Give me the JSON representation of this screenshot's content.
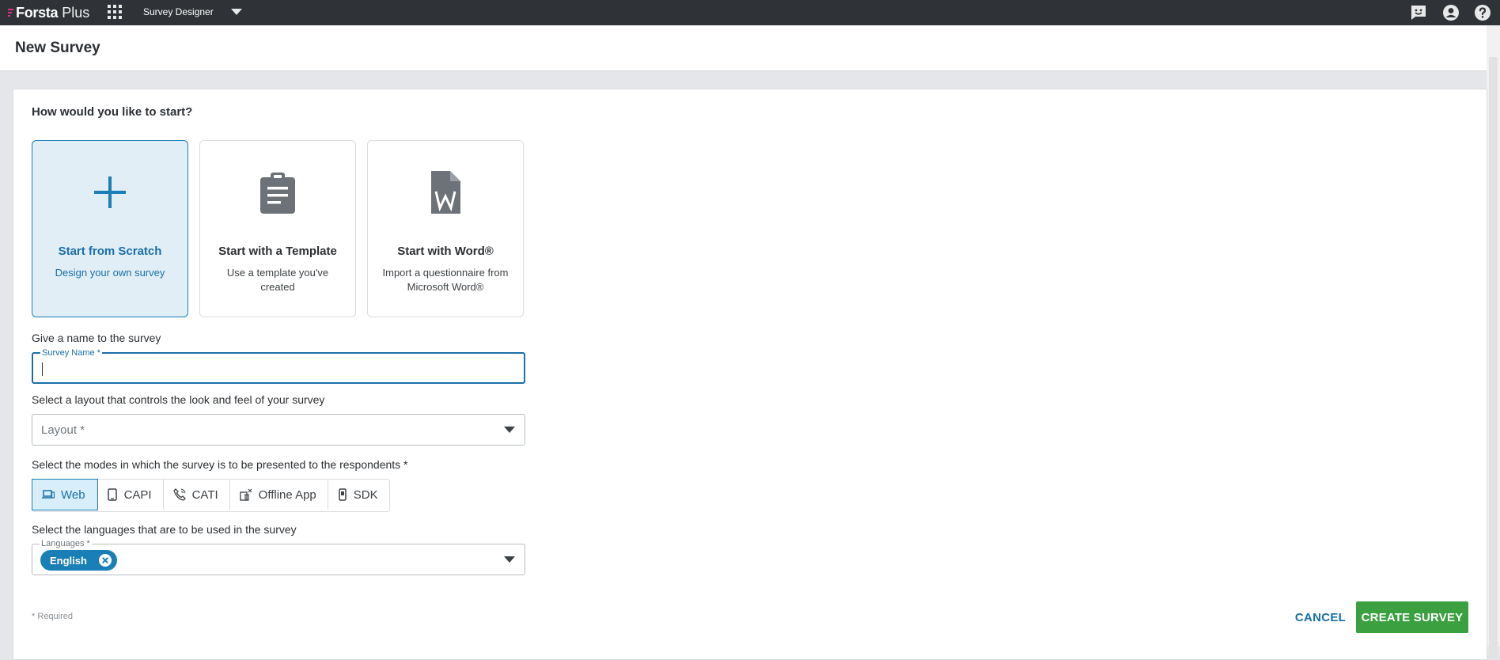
{
  "topbar": {
    "brand": "Forsta",
    "brand_suffix": "Plus",
    "app_name": "Survey Designer",
    "icons": [
      "apps-grid-icon",
      "chevron-down-icon",
      "feedback-icon",
      "account-icon",
      "help-icon"
    ]
  },
  "header": {
    "title": "New Survey"
  },
  "form": {
    "start_question": "How would you like to start?",
    "options": [
      {
        "title": "Start from Scratch",
        "desc": "Design your own survey",
        "icon": "plus-icon"
      },
      {
        "title": "Start with a Template",
        "desc": "Use a template you've created",
        "icon": "clipboard-icon"
      },
      {
        "title": "Start with Word®",
        "desc": "Import a questionnaire from Microsoft Word®",
        "icon": "word-document-icon"
      }
    ],
    "selected_option": "Start from Scratch",
    "name_question": "Give a name to the survey",
    "name_label": "Survey Name *",
    "name_value": "",
    "layout_question": "Select a layout that controls the look and feel of your survey",
    "layout_placeholder": "Layout *",
    "modes_question": "Select the modes in which the survey is to be presented to the respondents *",
    "modes": [
      {
        "label": "Web",
        "icon": "laptop-icon"
      },
      {
        "label": "CAPI",
        "icon": "tablet-icon"
      },
      {
        "label": "CATI",
        "icon": "phone-icon"
      },
      {
        "label": "Offline App",
        "icon": "offline-app-icon"
      },
      {
        "label": "SDK",
        "icon": "mobile-sdk-icon"
      }
    ],
    "active_mode": "Web",
    "languages_question": "Select the languages that are to be used in the survey",
    "languages_label": "Languages *",
    "languages_selected": [
      "English"
    ],
    "required_note": "* Required"
  },
  "actions": {
    "cancel": "CANCEL",
    "create": "CREATE SURVEY"
  },
  "colors": {
    "topbar": "#2f3337",
    "accent": "#1a7fb6",
    "brand_mark": "#e0308c",
    "create_button": "#3aa040",
    "selected_card_bg": "#e1eef6"
  }
}
